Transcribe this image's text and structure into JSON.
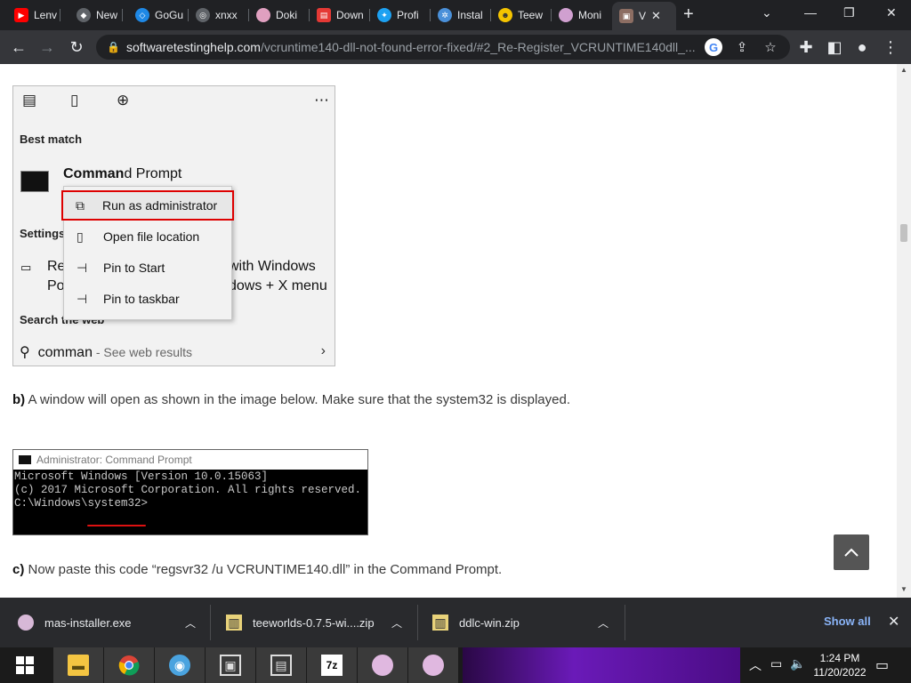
{
  "tabs": [
    {
      "title": "Lenv",
      "icon": "youtube-icon",
      "color": "#ff0000"
    },
    {
      "title": "New",
      "icon": "shield-icon",
      "color": "#5f6368"
    },
    {
      "title": "GoGu",
      "icon": "shield-blue-icon",
      "color": "#1e88e5"
    },
    {
      "title": "xnxx",
      "icon": "globe-icon",
      "color": "#5f6368"
    },
    {
      "title": "Doki",
      "icon": "avatar-icon",
      "color": "#e0a0c0"
    },
    {
      "title": "Down",
      "icon": "download-site-icon",
      "color": "#e53935"
    },
    {
      "title": "Profi",
      "icon": "twitter-icon",
      "color": "#1da1f2"
    },
    {
      "title": "Instal",
      "icon": "snowflake-icon",
      "color": "#4a90d9"
    },
    {
      "title": "Teew",
      "icon": "teeworlds-icon",
      "color": "#f5c400"
    },
    {
      "title": "Moni",
      "icon": "avatar-icon",
      "color": "#d0a0d0"
    },
    {
      "title": "V",
      "icon": "cube-icon",
      "color": "#8d6e63"
    }
  ],
  "address": {
    "host": "softwaretestinghelp.com",
    "path": "/vcruntime140-dll-not-found-error-fixed/#2_Re-Register_VCRUNTIME140dll_..."
  },
  "search_panel": {
    "best_match": "Best match",
    "app_name_bold": "Comman",
    "app_name_rest": "d Prompt",
    "settings_heading": "Settings",
    "settings_row1_left": "Re",
    "settings_row1_right": "with Windows",
    "settings_row2_left": "Po",
    "settings_row2_right": "dows + X menu",
    "search_web_heading": "Search the web",
    "query": "comman",
    "query_hint": " - See web results"
  },
  "context_menu": [
    {
      "label": "Run as administrator",
      "icon": "run-as-admin-icon",
      "highlighted": true
    },
    {
      "label": "Open file location",
      "icon": "file-location-icon"
    },
    {
      "label": "Pin to Start",
      "icon": "pin-icon"
    },
    {
      "label": "Pin to taskbar",
      "icon": "pin-icon"
    }
  ],
  "article": {
    "para_b_marker": "b)",
    "para_b_text": " A window will open as shown in the image below. Make sure that the system32 is displayed.",
    "para_c_marker": "c)",
    "para_c_text": " Now paste this code “regsvr32 /u VCRUNTIME140.dll” in the Command Prompt."
  },
  "cmd_window": {
    "title": "Administrator: Command Prompt",
    "lines": [
      "Microsoft Windows [Version 10.0.15063]",
      "(c) 2017 Microsoft Corporation. All rights reserved.",
      "",
      "C:\\Windows\\system32>"
    ]
  },
  "downloads": {
    "items": [
      {
        "name": "mas-installer.exe",
        "icon": "installer-icon"
      },
      {
        "name": "teeworlds-0.7.5-wi....zip",
        "icon": "zip-icon"
      },
      {
        "name": "ddlc-win.zip",
        "icon": "zip-icon"
      }
    ],
    "show_all": "Show all"
  },
  "taskbar": {
    "time": "1:24 PM",
    "date": "11/20/2022"
  }
}
